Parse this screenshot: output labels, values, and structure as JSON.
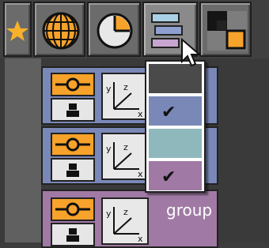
{
  "toolbar": {
    "buttons": [
      {
        "icon": "star-icon",
        "color": "#f7b12a"
      },
      {
        "icon": "globe-icon",
        "color": "#f7a22a"
      },
      {
        "icon": "clock-icon",
        "color": "#f7a22a"
      },
      {
        "icon": "layer-colors-icon",
        "active": true
      },
      {
        "icon": "checker-icon",
        "color": "#f7a22a"
      }
    ]
  },
  "rows": [
    {
      "label": "o",
      "color": "#7a88b8"
    },
    {
      "label": "o",
      "color": "#7a88b8"
    },
    {
      "label": "group",
      "color": "#a07aa5"
    }
  ],
  "color_menu": {
    "options": [
      {
        "color": "#4a4a4a",
        "checked": false
      },
      {
        "color": "#7a88b8",
        "checked": true
      },
      {
        "color": "#8fb8bc",
        "checked": false
      },
      {
        "color": "#a07aa5",
        "checked": true
      }
    ],
    "check_glyph": "✔"
  }
}
